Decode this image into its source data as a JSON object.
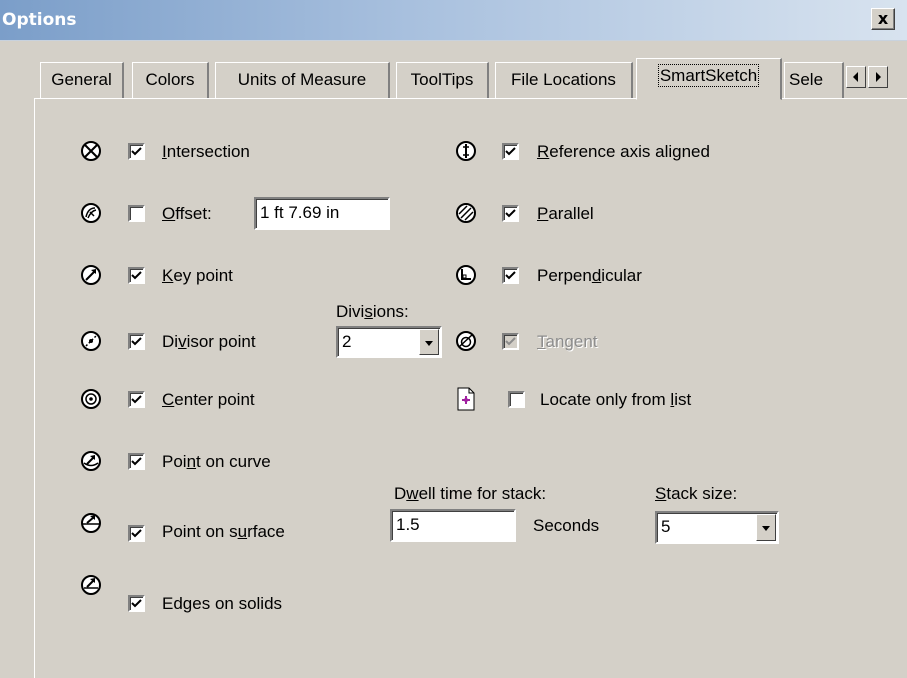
{
  "window": {
    "title": "Options",
    "close_label": "x"
  },
  "tabs": [
    {
      "label": "General",
      "active": false
    },
    {
      "label": "Colors",
      "active": false
    },
    {
      "label": "Units of Measure",
      "active": false
    },
    {
      "label": "ToolTips",
      "active": false
    },
    {
      "label": "File Locations",
      "active": false
    },
    {
      "label": "SmartSketch",
      "active": true
    },
    {
      "label": "Sele",
      "active": false
    }
  ],
  "tab_scroll": {
    "left_icon": "triangle-left-icon",
    "right_icon": "triangle-right-icon"
  },
  "left_column": {
    "intersection": {
      "label_u": "I",
      "label_rest": "ntersection",
      "checked": true,
      "icon": "intersection-icon"
    },
    "offset": {
      "label_u": "O",
      "label_rest": "ffset:",
      "checked": false,
      "icon": "offset-icon",
      "value": "1 ft  7.69 in"
    },
    "key_point": {
      "label_u": "K",
      "label_rest": "ey point",
      "checked": true,
      "icon": "key-point-icon"
    },
    "divisor_point": {
      "label_pre": "Di",
      "label_u": "v",
      "label_rest": "isor point",
      "checked": true,
      "icon": "divisor-point-icon"
    },
    "center_point": {
      "label_u": "C",
      "label_rest": "enter point",
      "checked": true,
      "icon": "center-point-icon"
    },
    "point_on_curve": {
      "label_pre": "Poi",
      "label_u": "n",
      "label_rest": "t on curve",
      "checked": true,
      "icon": "point-on-curve-icon"
    },
    "point_on_surface": {
      "label_pre": "Point on s",
      "label_u": "u",
      "label_rest": "rface",
      "checked": true,
      "icon": "point-on-surface-icon"
    },
    "edges_on_solids": {
      "label_pre": "Ed",
      "label_u": "g",
      "label_rest": "es on solids",
      "checked": true,
      "icon": "edges-on-solids-icon"
    }
  },
  "divisions": {
    "label_pre": "Divi",
    "label_u": "s",
    "label_rest": "ions:",
    "value": "2"
  },
  "right_column": {
    "reference_axis": {
      "label_u": "R",
      "label_rest": "eference axis aligned",
      "checked": true,
      "icon": "reference-axis-icon"
    },
    "parallel": {
      "label_u": "P",
      "label_rest": "arallel",
      "checked": true,
      "icon": "parallel-icon"
    },
    "perpendicular": {
      "label_pre": "Perpen",
      "label_u": "d",
      "label_rest": "icular",
      "checked": true,
      "icon": "perpendicular-icon"
    },
    "tangent": {
      "label_u": "T",
      "label_rest": "angent",
      "checked": true,
      "disabled": true,
      "icon": "tangent-icon"
    },
    "locate_only": {
      "label_pre": "Locate only from ",
      "label_u": "l",
      "label_rest": "ist",
      "checked": false,
      "icon": "locate-list-icon"
    }
  },
  "dwell": {
    "label_pre": "D",
    "label_u": "w",
    "label_rest": "ell time for stack:",
    "value": "1.5",
    "unit": "Seconds"
  },
  "stack": {
    "label_u": "S",
    "label_rest": "tack size:",
    "value": "5"
  }
}
